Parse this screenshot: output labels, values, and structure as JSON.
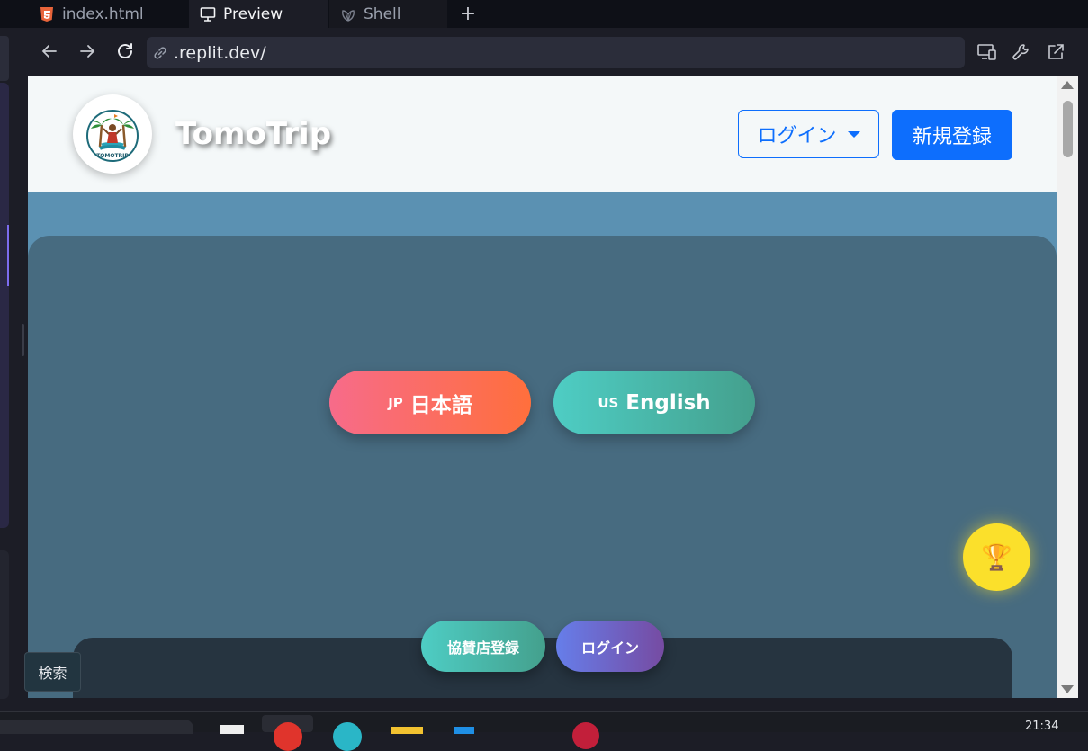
{
  "ide": {
    "tabs": [
      {
        "label": "index.html",
        "icon": "html5-icon"
      },
      {
        "label": "Preview",
        "icon": "monitor-icon"
      },
      {
        "label": "Shell",
        "icon": "shell-icon"
      }
    ],
    "add_tab": "+",
    "url": ".replit.dev/",
    "search_tooltip": "検索",
    "clock": "21:34"
  },
  "site": {
    "brand": "TomoTrip",
    "logo_text": "TOMOTRIP",
    "login_label": "ログイン",
    "signup_label": "新規登録",
    "lang_jp": {
      "code": "JP",
      "label": "日本語"
    },
    "lang_en": {
      "code": "US",
      "label": "English"
    },
    "sponsor_label": "協賛店登録",
    "login2_label": "ログイン",
    "trophy": "🏆"
  },
  "colors": {
    "primary": "#0d6efd",
    "jp_gradient": [
      "#f76b8a",
      "#ff6f3c"
    ],
    "en_gradient": [
      "#4ecdc4",
      "#44a08d"
    ],
    "login_gradient": [
      "#667eea",
      "#764ba2"
    ],
    "trophy": "#fbe02b"
  }
}
